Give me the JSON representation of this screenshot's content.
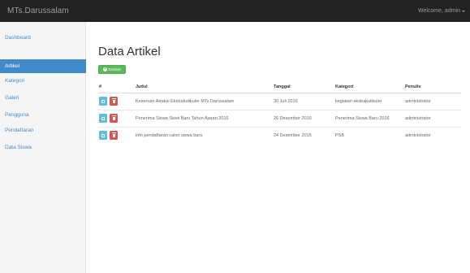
{
  "navbar": {
    "brand": "MTs.Darussalam",
    "welcome": "Welcome, admin"
  },
  "sidebar": {
    "items": [
      {
        "label": "Dashboard",
        "active": false
      },
      {
        "label": "Artikel",
        "active": true
      },
      {
        "label": "Kategori",
        "active": false
      },
      {
        "label": "Galeri",
        "active": false
      },
      {
        "label": "Pengguna",
        "active": false
      },
      {
        "label": "Pendaftaran",
        "active": false
      },
      {
        "label": "Data Siswa",
        "active": false
      }
    ]
  },
  "main": {
    "title": "Data Artikel",
    "add_button": "Tambah",
    "table": {
      "headers": [
        "#",
        "Judul",
        "Tanggal",
        "Kategori",
        "Penulis"
      ],
      "rows": [
        {
          "judul": "Keseruan Atraksi Ekstrakulikuler MTs Darussalam",
          "tanggal": "30 Juli 2016",
          "kategori": "kegiatan ekstrakulikuler",
          "penulis": "administrator"
        },
        {
          "judul": "Penerima Siswa Siswi Baru Tahun Ajaran 2016",
          "tanggal": "26 Desember 2015",
          "kategori": "Penerima Siswa Baru 2016",
          "penulis": "administrator"
        },
        {
          "judul": "info pendaftaran calon siswa baru",
          "tanggal": "24 Desember 2015",
          "kategori": "PSB",
          "penulis": "administrator"
        }
      ]
    }
  },
  "colors": {
    "navbar_bg": "#222222",
    "primary": "#428bca",
    "success": "#5cb85c",
    "info": "#5bc0de",
    "danger": "#d9534f"
  }
}
